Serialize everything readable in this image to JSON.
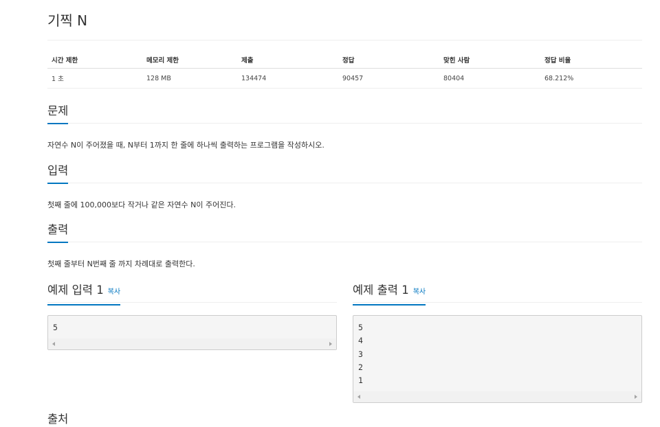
{
  "problem": {
    "title": "기찍 N"
  },
  "info_table": {
    "headers": [
      "시간 제한",
      "메모리 제한",
      "제출",
      "정답",
      "맞힌 사람",
      "정답 비율"
    ],
    "values": [
      "1 초",
      "128 MB",
      "134474",
      "90457",
      "80404",
      "68.212%"
    ]
  },
  "sections": {
    "description": {
      "title": "문제",
      "text": "자연수 N이 주어졌을 때, N부터 1까지 한 줄에 하나씩 출력하는 프로그램을 작성하시오."
    },
    "input": {
      "title": "입력",
      "text": "첫째 줄에 100,000보다 작거나 같은 자연수 N이 주어진다."
    },
    "output": {
      "title": "출력",
      "text": "첫째 줄부터 N번째 줄 까지 차례대로 출력한다."
    }
  },
  "samples": {
    "input": {
      "title": "예제 입력 1",
      "copy_label": "복사",
      "lines": [
        "5"
      ]
    },
    "output": {
      "title": "예제 출력 1",
      "copy_label": "복사",
      "lines": [
        "5",
        "4",
        "3",
        "2",
        "1"
      ]
    }
  },
  "next_section_title": "출처"
}
